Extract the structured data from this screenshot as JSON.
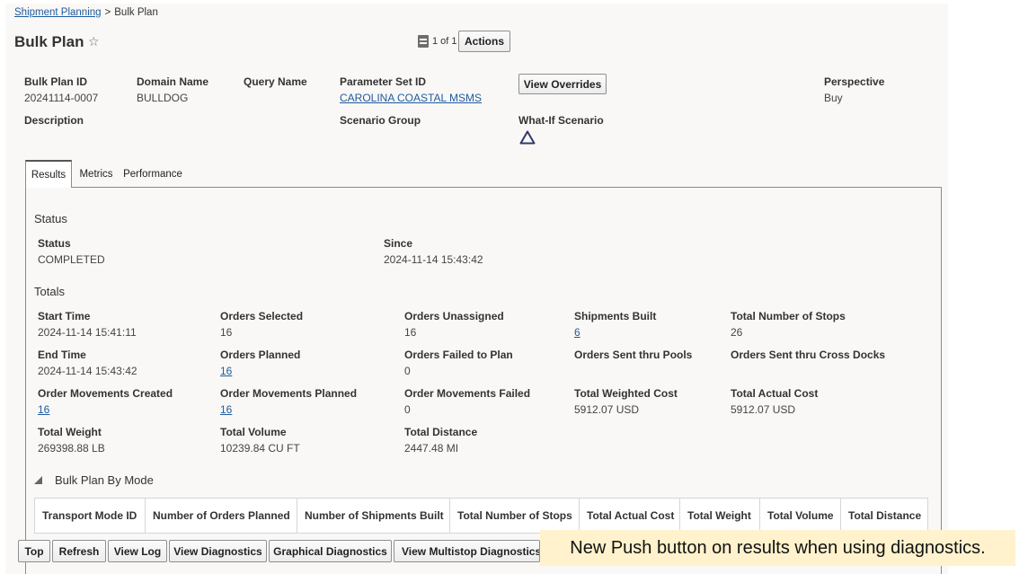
{
  "breadcrumb": {
    "parent": "Shipment Planning",
    "separator": ">",
    "current": "Bulk Plan"
  },
  "header": {
    "title": "Bulk Plan",
    "pager": "1 of 1",
    "actions_label": "Actions"
  },
  "fields": {
    "bulk_plan_id": {
      "label": "Bulk Plan ID",
      "value": "20241114-0007"
    },
    "domain_name": {
      "label": "Domain Name",
      "value": "BULLDOG"
    },
    "query_name": {
      "label": "Query Name"
    },
    "parameter_set_id": {
      "label": "Parameter Set ID",
      "value": "CAROLINA COASTAL MSMS"
    },
    "view_overrides_label": "View Overrides",
    "perspective": {
      "label": "Perspective",
      "value": "Buy"
    },
    "description": {
      "label": "Description"
    },
    "scenario_group": {
      "label": "Scenario Group"
    },
    "what_if_scenario": {
      "label": "What-If Scenario"
    }
  },
  "tabs": [
    {
      "label": "Results",
      "active": true
    },
    {
      "label": "Metrics",
      "active": false
    },
    {
      "label": "Performance",
      "active": false
    }
  ],
  "status_section": {
    "title": "Status",
    "status": {
      "label": "Status",
      "value": "COMPLETED"
    },
    "since": {
      "label": "Since",
      "value": "2024-11-14 15:43:42"
    }
  },
  "totals": {
    "title": "Totals",
    "start_time": {
      "label": "Start Time",
      "value": "2024-11-14 15:41:11"
    },
    "orders_selected": {
      "label": "Orders Selected",
      "value": "16"
    },
    "orders_unassigned": {
      "label": "Orders Unassigned",
      "value": "16"
    },
    "shipments_built": {
      "label": "Shipments Built",
      "value": "6"
    },
    "total_stops": {
      "label": "Total Number of Stops",
      "value": "26"
    },
    "end_time": {
      "label": "End Time",
      "value": "2024-11-14 15:43:42"
    },
    "orders_planned": {
      "label": "Orders Planned",
      "value": "16"
    },
    "orders_failed": {
      "label": "Orders Failed to Plan",
      "value": "0"
    },
    "orders_pools": {
      "label": "Orders Sent thru Pools"
    },
    "orders_cross_docks": {
      "label": "Orders Sent thru Cross Docks"
    },
    "om_created": {
      "label": "Order Movements Created",
      "value": "16"
    },
    "om_planned": {
      "label": "Order Movements Planned",
      "value": "16"
    },
    "om_failed": {
      "label": "Order Movements Failed",
      "value": "0"
    },
    "total_weighted_cost": {
      "label": "Total Weighted Cost",
      "value": "5912.07 USD"
    },
    "total_actual_cost": {
      "label": "Total Actual Cost",
      "value": "5912.07 USD"
    },
    "total_weight": {
      "label": "Total Weight",
      "value": "269398.88 LB"
    },
    "total_volume": {
      "label": "Total Volume",
      "value": "10239.84 CU FT"
    },
    "total_distance": {
      "label": "Total Distance",
      "value": "2447.48 MI"
    }
  },
  "by_mode": {
    "title": "Bulk Plan By Mode",
    "columns": [
      "Transport Mode ID",
      "Number of Orders Planned",
      "Number of Shipments Built",
      "Total Number of Stops",
      "Total Actual Cost",
      "Total Weight",
      "Total Volume",
      "Total Distance"
    ]
  },
  "bottom_buttons": [
    "Top",
    "Refresh",
    "View Log",
    "View Diagnostics",
    "Graphical Diagnostics",
    "View Multistop Diagnostics"
  ],
  "callout": "New Push button on results when using diagnostics.",
  "icons": {
    "star": "star-outline-icon",
    "doc": "document-icon",
    "what_if": "triangle-outline-icon",
    "collapse": "collapse-triangle-icon"
  },
  "colors": {
    "link": "#1f5b9e",
    "callout_bg": "#fff2cc",
    "page_bg": "#f9f8f6"
  }
}
